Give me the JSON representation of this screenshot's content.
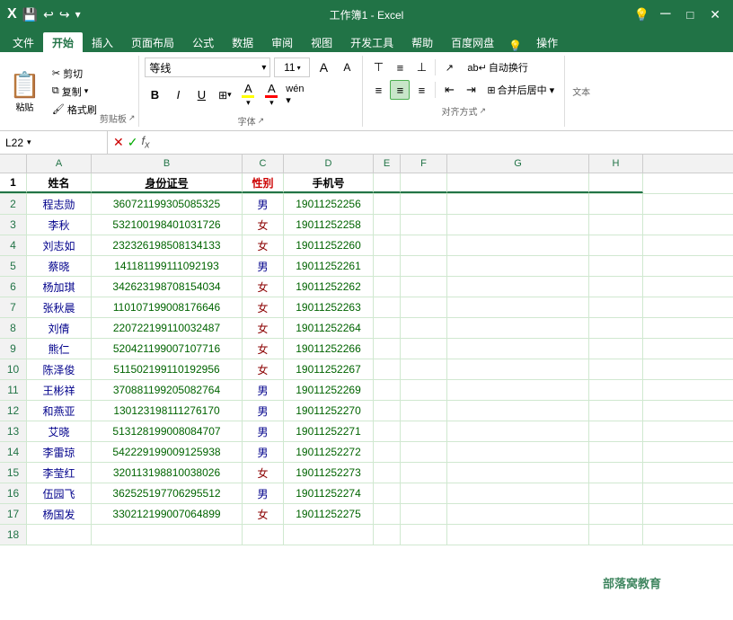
{
  "titlebar": {
    "title": "工作簿1 - Excel"
  },
  "tabs": [
    {
      "label": "文件",
      "active": false
    },
    {
      "label": "开始",
      "active": true
    },
    {
      "label": "插入",
      "active": false
    },
    {
      "label": "页面布局",
      "active": false
    },
    {
      "label": "公式",
      "active": false
    },
    {
      "label": "数据",
      "active": false
    },
    {
      "label": "审阅",
      "active": false
    },
    {
      "label": "视图",
      "active": false
    },
    {
      "label": "开发工具",
      "active": false
    },
    {
      "label": "帮助",
      "active": false
    },
    {
      "label": "百度网盘",
      "active": false
    },
    {
      "label": "操作",
      "active": false
    }
  ],
  "ribbon": {
    "clipboard": {
      "paste": "粘贴",
      "cut": "✂ 剪切",
      "copy": "⧉ 复制 ▾",
      "format": "🖌 格式刷",
      "label": "剪贴板"
    },
    "font": {
      "name": "等线",
      "size": "11",
      "label": "字体",
      "bold": "B",
      "italic": "I",
      "underline": "U"
    },
    "alignment": {
      "label": "对齐方式",
      "wrap": "自动换行",
      "merge": "合并后居中 ▾"
    }
  },
  "formulabar": {
    "cellref": "L22",
    "formula": ""
  },
  "columns": [
    {
      "label": "",
      "key": "rownum"
    },
    {
      "label": "A",
      "key": "a"
    },
    {
      "label": "B",
      "key": "b"
    },
    {
      "label": "C",
      "key": "c"
    },
    {
      "label": "D",
      "key": "d"
    },
    {
      "label": "E",
      "key": "e"
    },
    {
      "label": "F",
      "key": "f"
    },
    {
      "label": "G",
      "key": "g"
    },
    {
      "label": "H",
      "key": "h"
    }
  ],
  "rows": [
    {
      "num": "1",
      "a": "姓名",
      "b": "身份证号",
      "c": "性别",
      "d": "手机号",
      "e": "",
      "f": "",
      "g": "",
      "h": "",
      "header": true
    },
    {
      "num": "2",
      "a": "程志勋",
      "b": "360721199305085325",
      "c": "男",
      "d": "19011252256",
      "e": "",
      "f": "",
      "g": "",
      "h": ""
    },
    {
      "num": "3",
      "a": "李秋",
      "b": "532100198401031726",
      "c": "女",
      "d": "19011252258",
      "e": "",
      "f": "",
      "g": "",
      "h": ""
    },
    {
      "num": "4",
      "a": "刘志如",
      "b": "232326198508134133",
      "c": "女",
      "d": "19011252260",
      "e": "",
      "f": "",
      "g": "",
      "h": ""
    },
    {
      "num": "5",
      "a": "蔡晓",
      "b": "141181199111092193",
      "c": "男",
      "d": "19011252261",
      "e": "",
      "f": "",
      "g": "",
      "h": ""
    },
    {
      "num": "6",
      "a": "杨加琪",
      "b": "342623198708154034",
      "c": "女",
      "d": "19011252262",
      "e": "",
      "f": "",
      "g": "",
      "h": ""
    },
    {
      "num": "7",
      "a": "张秋晨",
      "b": "110107199008176646",
      "c": "女",
      "d": "19011252263",
      "e": "",
      "f": "",
      "g": "",
      "h": ""
    },
    {
      "num": "8",
      "a": "刘倩",
      "b": "220722199110032487",
      "c": "女",
      "d": "19011252264",
      "e": "",
      "f": "",
      "g": "",
      "h": ""
    },
    {
      "num": "9",
      "a": "熊仁",
      "b": "520421199007107716",
      "c": "女",
      "d": "19011252266",
      "e": "",
      "f": "",
      "g": "",
      "h": ""
    },
    {
      "num": "10",
      "a": "陈泽俊",
      "b": "511502199110192956",
      "c": "女",
      "d": "19011252267",
      "e": "",
      "f": "",
      "g": "",
      "h": ""
    },
    {
      "num": "11",
      "a": "王彬祥",
      "b": "370881199205082764",
      "c": "男",
      "d": "19011252269",
      "e": "",
      "f": "",
      "g": "",
      "h": ""
    },
    {
      "num": "12",
      "a": "和燕亚",
      "b": "130123198111276170",
      "c": "男",
      "d": "19011252270",
      "e": "",
      "f": "",
      "g": "",
      "h": ""
    },
    {
      "num": "13",
      "a": "艾晓",
      "b": "513128199008084707",
      "c": "男",
      "d": "19011252271",
      "e": "",
      "f": "",
      "g": "",
      "h": ""
    },
    {
      "num": "14",
      "a": "李雷琼",
      "b": "542229199009125938",
      "c": "男",
      "d": "19011252272",
      "e": "",
      "f": "",
      "g": "",
      "h": ""
    },
    {
      "num": "15",
      "a": "李莹红",
      "b": "320113198810038026",
      "c": "女",
      "d": "19011252273",
      "e": "",
      "f": "",
      "g": "",
      "h": ""
    },
    {
      "num": "16",
      "a": "伍园飞",
      "b": "362525197706295512",
      "c": "男",
      "d": "19011252274",
      "e": "",
      "f": "",
      "g": "",
      "h": ""
    },
    {
      "num": "17",
      "a": "杨国发",
      "b": "330212199007064899",
      "c": "女",
      "d": "19011252275",
      "e": "",
      "f": "",
      "g": "",
      "h": ""
    },
    {
      "num": "18",
      "a": "",
      "b": "",
      "c": "",
      "d": "",
      "e": "",
      "f": "",
      "g": "",
      "h": ""
    }
  ],
  "watermark": "部落窝教育",
  "colors": {
    "excel_green": "#217346",
    "light_green_border": "#d0e8d0",
    "header_text": "#217346"
  }
}
